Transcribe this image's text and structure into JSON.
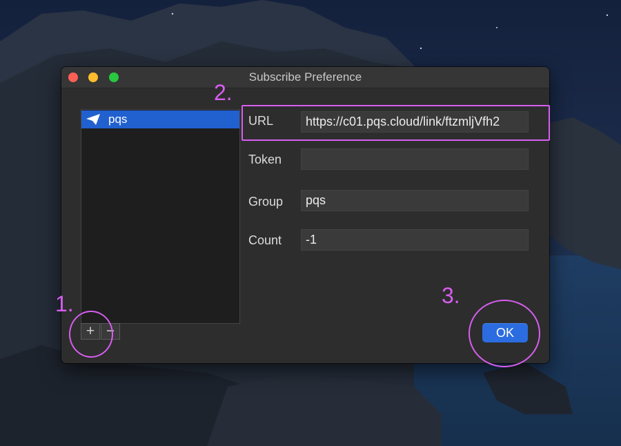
{
  "window": {
    "title": "Subscribe Preference",
    "traffic_lights": [
      "close",
      "minimize",
      "zoom"
    ]
  },
  "subscription_list": {
    "items": [
      {
        "label": "pqs",
        "icon": "paper-plane-icon",
        "selected": true
      }
    ]
  },
  "list_controls": {
    "add": "+",
    "remove": "−"
  },
  "form": {
    "url": {
      "label": "URL",
      "value": "https://c01.pqs.cloud/link/ftzmljVfh2"
    },
    "token": {
      "label": "Token",
      "value": ""
    },
    "group": {
      "label": "Group",
      "value": "pqs"
    },
    "count": {
      "label": "Count",
      "value": "-1"
    }
  },
  "ok_button": {
    "label": "OK"
  },
  "annotations": {
    "step1": "1.",
    "step2": "2.",
    "step3": "3."
  },
  "colors": {
    "annotation": "#d75ef0",
    "selection": "#2160cf",
    "ok_button": "#2b6ce0",
    "window_bg": "#2d2d2d"
  }
}
